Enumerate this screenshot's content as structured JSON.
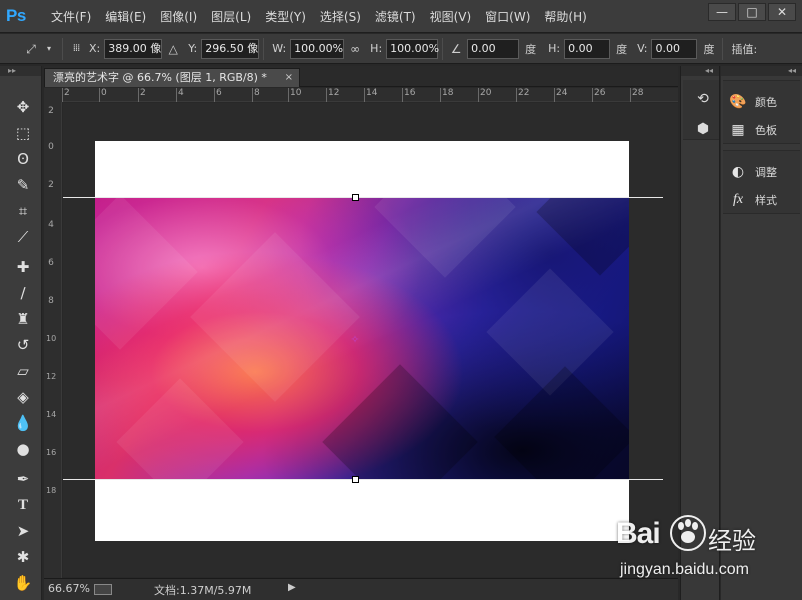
{
  "app": {
    "logo": "Ps"
  },
  "menu": [
    "文件(F)",
    "编辑(E)",
    "图像(I)",
    "图层(L)",
    "类型(Y)",
    "选择(S)",
    "滤镜(T)",
    "视图(V)",
    "窗口(W)",
    "帮助(H)"
  ],
  "window_controls": {
    "minimize": "—",
    "maximize": "□",
    "close": "✕"
  },
  "options": {
    "x_label": "X:",
    "x_value": "389.00 像",
    "y_label": "Y:",
    "y_value": "296.50 像",
    "w_label": "W:",
    "w_value": "100.00%",
    "h_label": "H:",
    "h_value": "100.00%",
    "angle_value": "0.00",
    "angle_unit": "度",
    "hskew_label": "H:",
    "hskew_value": "0.00",
    "hskew_unit": "度",
    "vskew_label": "V:",
    "vskew_value": "0.00",
    "vskew_unit": "度",
    "interp_label": "插值:"
  },
  "document": {
    "tab_title": "漂亮的艺术字 @ 66.7% (图层 1, RGB/8) *",
    "tab_close": "×"
  },
  "rulers": {
    "h_ticks": [
      "2",
      "0",
      "2",
      "4",
      "6",
      "8",
      "10",
      "12",
      "14",
      "16",
      "18",
      "20",
      "22",
      "24",
      "26",
      "28"
    ],
    "v_ticks": [
      "2",
      "0",
      "2",
      "4",
      "6",
      "8",
      "10",
      "12",
      "14",
      "16",
      "18"
    ]
  },
  "status": {
    "zoom": "66.67%",
    "doc_info": "文档:1.37M/5.97M",
    "arrow": "▶"
  },
  "panels": {
    "items": [
      {
        "label": "颜色",
        "icon": "palette-icon"
      },
      {
        "label": "色板",
        "icon": "swatches-icon"
      },
      {
        "label": "调整",
        "icon": "adjustments-icon"
      },
      {
        "label": "样式",
        "icon": "styles-icon"
      }
    ]
  },
  "watermark": {
    "brand": "Bai",
    "brand_cn": "经验",
    "url": "jingyan.baidu.com"
  }
}
